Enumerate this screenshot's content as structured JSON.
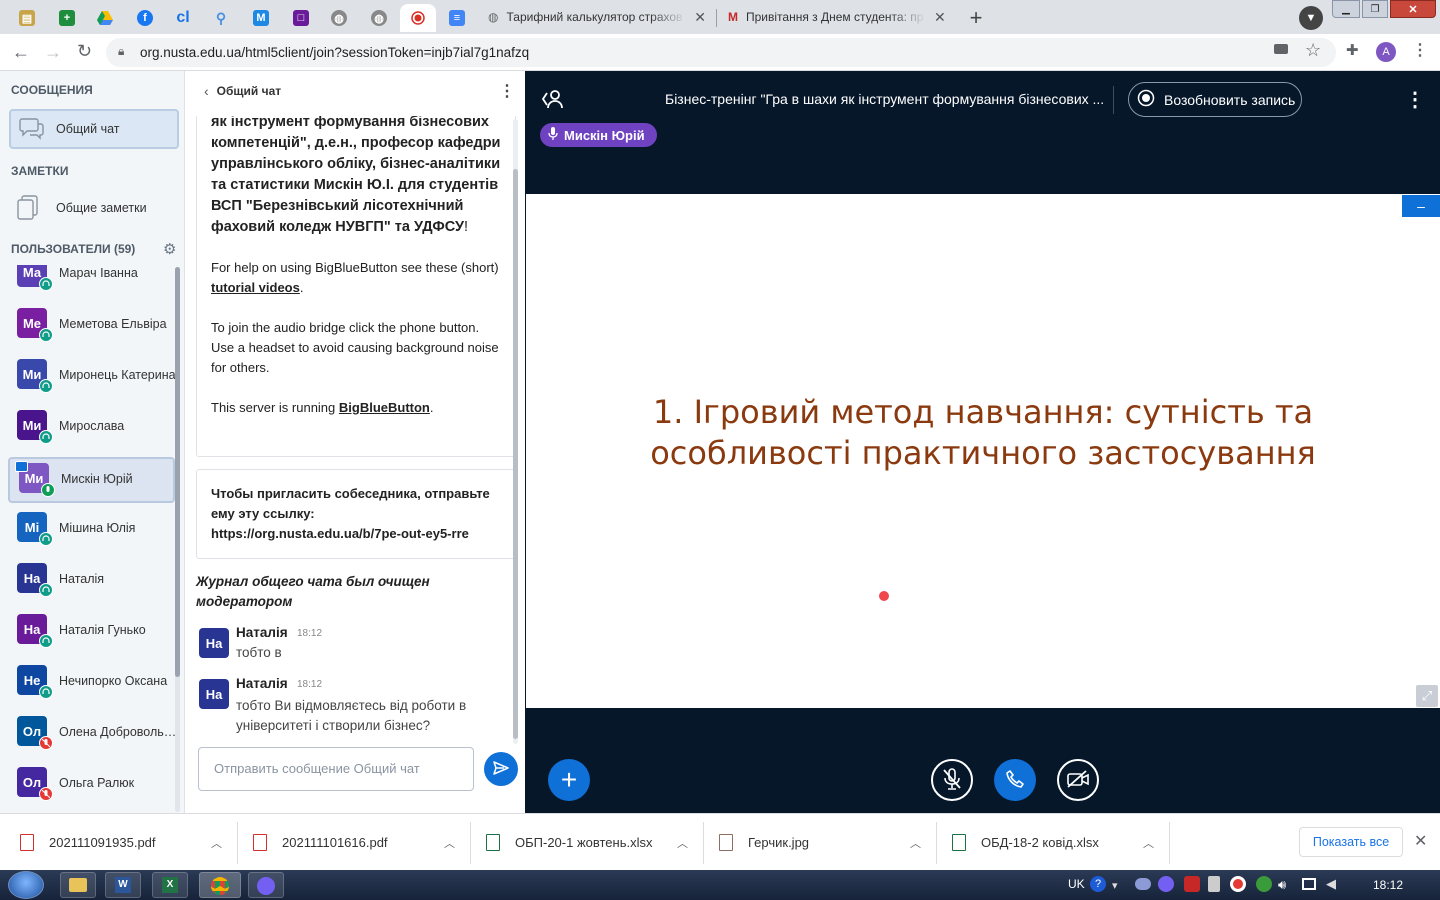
{
  "browser": {
    "tabs": [
      {
        "title": "Тарифний калькулятор страхов"
      },
      {
        "title": "Привітання з Днем студента: пр"
      }
    ],
    "url": "org.nusta.edu.ua/html5client/join?sessionToken=injb7ial7g1nafzq",
    "profile_initial": "A"
  },
  "sidebar": {
    "messages_heading": "СООБЩЕНИЯ",
    "public_chat_label": "Общий чат",
    "notes_heading": "ЗАМЕТКИ",
    "shared_notes_label": "Общие заметки",
    "users_heading": "ПОЛЬЗОВАТЕЛИ (59)",
    "users": [
      {
        "initials": "Ма",
        "name": "Марач Іванна",
        "color": "#5b3fb4",
        "mic": "listen"
      },
      {
        "initials": "Ме",
        "name": "Меметова Ельвіра",
        "color": "#7b1fa2",
        "mic": "listen"
      },
      {
        "initials": "Ми",
        "name": "Миронець Катерина",
        "color": "#3949ab",
        "mic": "listen"
      },
      {
        "initials": "Ми",
        "name": "Мирослава",
        "color": "#4a148c",
        "mic": "listen"
      },
      {
        "initials": "Ми",
        "name": "Мискін Юрій",
        "color": "#7e57c2",
        "mic": "talk"
      },
      {
        "initials": "Мі",
        "name": "Мішина Юлія",
        "color": "#1565c0",
        "mic": "listen"
      },
      {
        "initials": "На",
        "name": "Наталія",
        "color": "#283593",
        "mic": "listen"
      },
      {
        "initials": "На",
        "name": "Наталія Гунько",
        "color": "#6a1b9a",
        "mic": "listen"
      },
      {
        "initials": "Не",
        "name": "Нечипорко Оксана",
        "color": "#0d47a1",
        "mic": "listen"
      },
      {
        "initials": "Ол",
        "name": "Олена Добровольська",
        "color": "#01579b",
        "mic": "muted"
      },
      {
        "initials": "Ол",
        "name": "Ольга Ралюк",
        "color": "#4527a0",
        "mic": "muted"
      }
    ]
  },
  "chat": {
    "back_label": "Общий чат",
    "welcome_bold": "як інструмент формування бізнесових компетенцій\", д.е.н., професор кафедри управлінського обліку, бізнес-аналітики та статистики Мискін Ю.І. для студентів ВСП \"Березнівський лісотехнічний фаховий коледж НУВГП\" та УДФСУ",
    "welcome_bold_end": "!",
    "help_pre": "For help on using BigBlueButton see these (short) ",
    "help_link": "tutorial videos",
    "help_post": ".",
    "audio_text": "To join the audio bridge click the phone button. Use a headset to avoid causing background noise for others.",
    "server_pre": "This server is running ",
    "server_link": "BigBlueButton",
    "server_post": ".",
    "invite_text": "Чтобы пригласить собеседника, отправьте ему эту ссылку:",
    "invite_link": "https://org.nusta.edu.ua/b/7pe-out-ey5-rre",
    "cleared_notice": "Журнал общего чата был очищен модератором",
    "messages": [
      {
        "initials": "На",
        "author": "Наталія",
        "time": "18:12",
        "text": "тобто в"
      },
      {
        "initials": "На",
        "author": "Наталія",
        "time": "18:12",
        "text": "тобто Ви відмовляєтесь від роботи в університеті і створили бізнес?"
      }
    ],
    "input_placeholder": "Отправить сообщение Общий чат"
  },
  "meeting": {
    "title": "Бізнес-тренінг \"Гра в шахи як інструмент формування бізнесових ...",
    "record_label": "Возобновить запись",
    "talker": "Мискін Юрій",
    "slide_text_line1": "1. Ігровий метод навчання: сутність та",
    "slide_text_line2": "особливості практичного застосування"
  },
  "downloads": {
    "items": [
      {
        "name": "202111091935.pdf",
        "type": "pdf"
      },
      {
        "name": "202111101616.pdf",
        "type": "pdf"
      },
      {
        "name": "ОБП-20-1 жовтень.xlsx",
        "type": "xlsx"
      },
      {
        "name": "Герчик.jpg",
        "type": "jpg"
      },
      {
        "name": "ОБД-18-2 ковід.xlsx",
        "type": "xlsx"
      }
    ],
    "show_all": "Показать все"
  },
  "taskbar": {
    "lang": "UK",
    "clock": "18:12"
  },
  "colors": {
    "bbb_blue": "#0f70d7",
    "slide_text": "#8b3a0f",
    "presentation_bg": "#06172a"
  }
}
